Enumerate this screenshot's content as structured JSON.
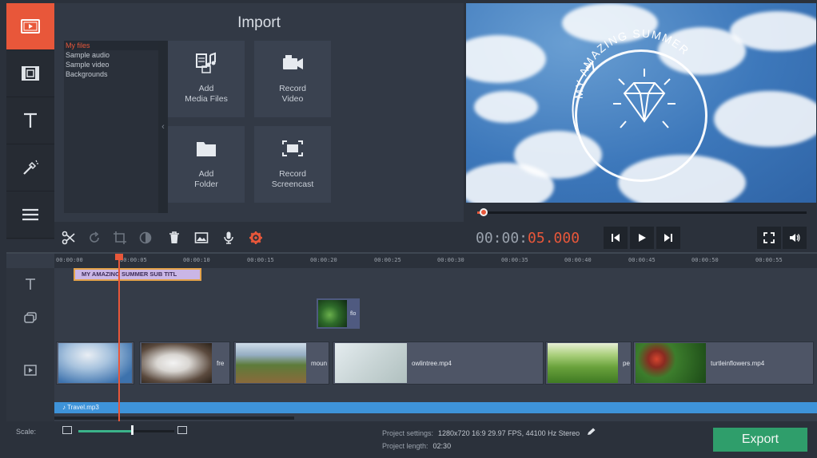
{
  "left_toolbar": {
    "items": [
      {
        "icon": "import-icon",
        "active": true
      },
      {
        "icon": "filters-icon",
        "active": false
      },
      {
        "icon": "titles-icon",
        "active": false
      },
      {
        "icon": "transitions-icon",
        "active": false
      },
      {
        "icon": "more-menu-icon",
        "active": false
      }
    ]
  },
  "import_panel": {
    "title": "Import",
    "file_list": [
      "My files",
      "Sample audio",
      "Sample video",
      "Backgrounds"
    ],
    "selected_file": "My files",
    "collapse_glyph": "‹",
    "tiles": [
      {
        "label_line1": "Add",
        "label_line2": "Media Files",
        "icon": "media-files-icon"
      },
      {
        "label_line1": "Record",
        "label_line2": "Video",
        "icon": "video-camera-icon"
      },
      {
        "label_line1": "Add",
        "label_line2": "Folder",
        "icon": "folder-icon"
      },
      {
        "label_line1": "Record",
        "label_line2": "Screencast",
        "icon": "screencast-icon"
      }
    ]
  },
  "preview": {
    "logo_text": "MY AMAZING SUMMER"
  },
  "player": {
    "timecode_a": "00:00:",
    "timecode_b": "05.000",
    "progress": 0.02,
    "buttons": [
      "skip-back-icon",
      "play-icon",
      "skip-forward-icon",
      "fullscreen-icon",
      "volume-icon"
    ]
  },
  "edit_toolbar": {
    "buttons": [
      "scissors-icon",
      "rotate-icon",
      "crop-icon",
      "color-adjust-icon",
      "trash-icon",
      "image-icon",
      "microphone-icon",
      "settings-icon"
    ]
  },
  "timeline": {
    "ruler_ticks": [
      "00:00:00",
      "00:00:05",
      "00:00:10",
      "00:00:15",
      "00:00:20",
      "00:00:25",
      "00:00:30",
      "00:00:35",
      "00:00:40",
      "00:00:45",
      "00:00:50",
      "00:00:55"
    ],
    "title_clip": "MY AMAZING SUMMER SUB TITL",
    "overlay_clip": "flo",
    "video_clips": [
      {
        "label": ""
      },
      {
        "label": "fre"
      },
      {
        "label": "moun"
      },
      {
        "label": "owlintree.mp4"
      },
      {
        "label": "pe"
      },
      {
        "label": "turtleinflowers.mp4"
      }
    ],
    "audio_clip": "Travel.mp3"
  },
  "footer": {
    "scale_label": "Scale:",
    "scale_value": 0.55,
    "project_settings_label": "Project settings:",
    "project_settings_value": "1280x720 16:9 29.97 FPS, 44100 Hz Stereo",
    "project_length_label": "Project length:",
    "project_length_value": "02:30",
    "export_label": "Export"
  },
  "colors": {
    "accent": "#e8573a",
    "export_green": "#2f9e6b",
    "audio_blue": "#3e93d9",
    "title_clip": "#cab6e6"
  }
}
